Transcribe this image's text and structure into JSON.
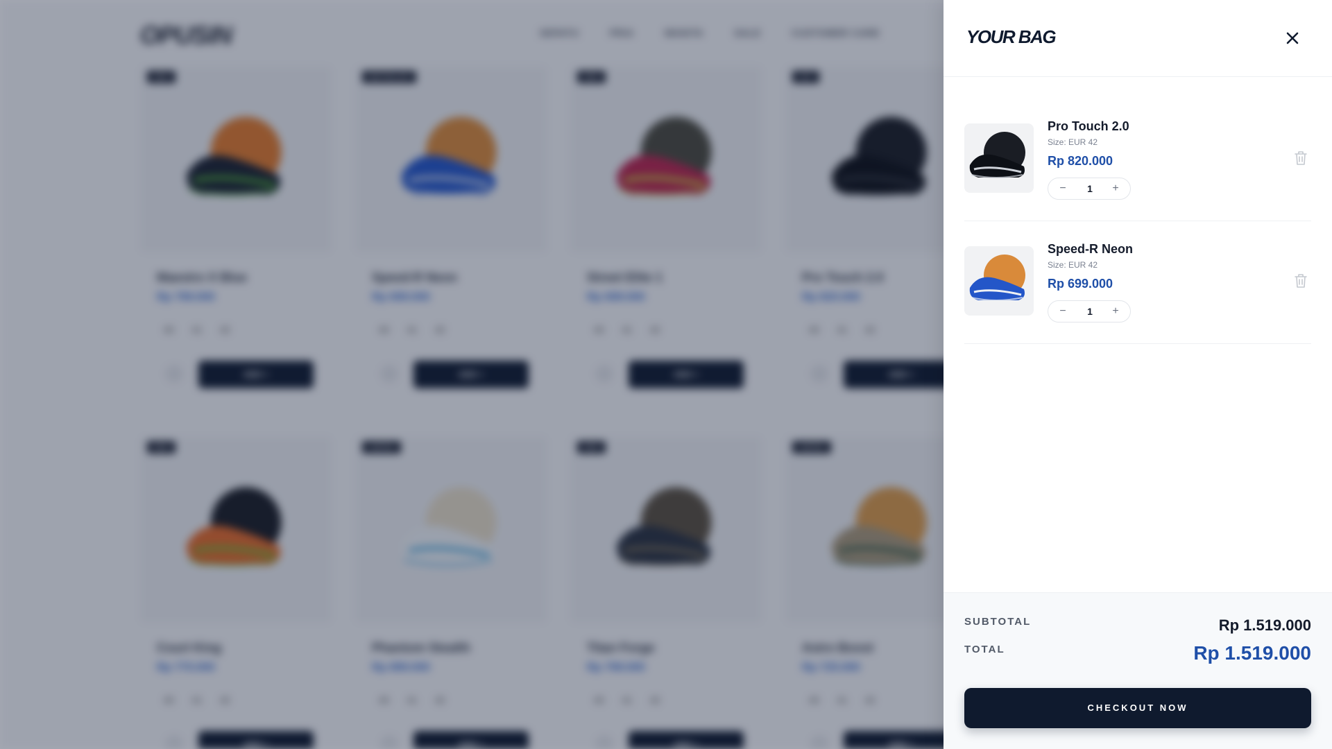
{
  "background_store": {
    "brand": "OPUSIN",
    "nav": [
      "SEPATU",
      "PRIA",
      "WANITA",
      "SALE",
      "CUSTOMER CARE"
    ],
    "products": [
      {
        "badge": "NEW",
        "name": "Maestro X Blue",
        "price": "Rp 799.000",
        "sizes": [
          "40",
          "41",
          "42"
        ],
        "add_label": "ADD +",
        "colors": [
          "#e07a2c",
          "#1b2230",
          "#5ec83a"
        ]
      },
      {
        "badge": "BESTSELLER",
        "name": "Speed-R Neon",
        "price": "Rp 699.000",
        "sizes": [
          "40",
          "41",
          "42"
        ],
        "add_label": "ADD +",
        "colors": [
          "#d98a3a",
          "#2456c8",
          "#e9ecef"
        ]
      },
      {
        "badge": "NEW",
        "name": "Street Elite 1",
        "price": "Rp 699.000",
        "sizes": [
          "40",
          "41",
          "42"
        ],
        "add_label": "ADD +",
        "colors": [
          "#4b4a3e",
          "#b8254e",
          "#c7e03a"
        ]
      },
      {
        "badge": "HOT",
        "name": "Pro Touch 2.0",
        "price": "Rp 820.000",
        "sizes": [
          "40",
          "41",
          "42"
        ],
        "add_label": "ADD +",
        "colors": [
          "#1a1d24",
          "#0d1016",
          "#3a3e48"
        ]
      },
      {
        "badge": "NEW",
        "name": "Court King",
        "price": "Rp 770.000",
        "sizes": [
          "40",
          "41",
          "42"
        ],
        "add_label": "ADD +",
        "colors": [
          "#1a1d24",
          "#e36a2a",
          "#57c23a"
        ]
      },
      {
        "badge": "LIMITED",
        "name": "Phantom Stealth",
        "price": "Rp 899.000",
        "sizes": [
          "40",
          "41",
          "42"
        ],
        "add_label": "ADD +",
        "colors": [
          "#e6dcc6",
          "#eef2f5",
          "#3aa0d8"
        ]
      },
      {
        "badge": "NEW",
        "name": "Titan Forge",
        "price": "Rp 799.000",
        "sizes": [
          "40",
          "41",
          "42"
        ],
        "add_label": "ADD +",
        "colors": [
          "#5a5040",
          "#2a3240",
          "#8a7a5a"
        ]
      },
      {
        "badge": "LIMITED",
        "name": "Astro Boost",
        "price": "Rp 725.000",
        "sizes": [
          "40",
          "41",
          "42"
        ],
        "add_label": "ADD +",
        "colors": [
          "#d99a4a",
          "#a8987a",
          "#2a5a48"
        ]
      }
    ]
  },
  "bag": {
    "title": "YOUR BAG",
    "items": [
      {
        "name": "Pro Touch 2.0",
        "size": "Size: EUR 42",
        "price": "Rp 820.000",
        "quantity": "1",
        "minus": "−",
        "plus": "+",
        "colors": [
          "#1a1d24",
          "#0d1016",
          "#cfd3da"
        ]
      },
      {
        "name": "Speed-R Neon",
        "size": "Size: EUR 42",
        "price": "Rp 699.000",
        "quantity": "1",
        "minus": "−",
        "plus": "+",
        "colors": [
          "#d98a3a",
          "#2456c8",
          "#eef1f4"
        ]
      }
    ],
    "subtotal_label": "SUBTOTAL",
    "subtotal_value": "Rp 1.519.000",
    "total_label": "TOTAL",
    "total_value": "Rp 1.519.000",
    "checkout_label": "CHECKOUT NOW"
  },
  "icons": {
    "close": "close-icon",
    "trash": "trash-icon"
  },
  "colors": {
    "accent_price": "#1f4fa8",
    "primary_dark": "#0f1a2e"
  }
}
